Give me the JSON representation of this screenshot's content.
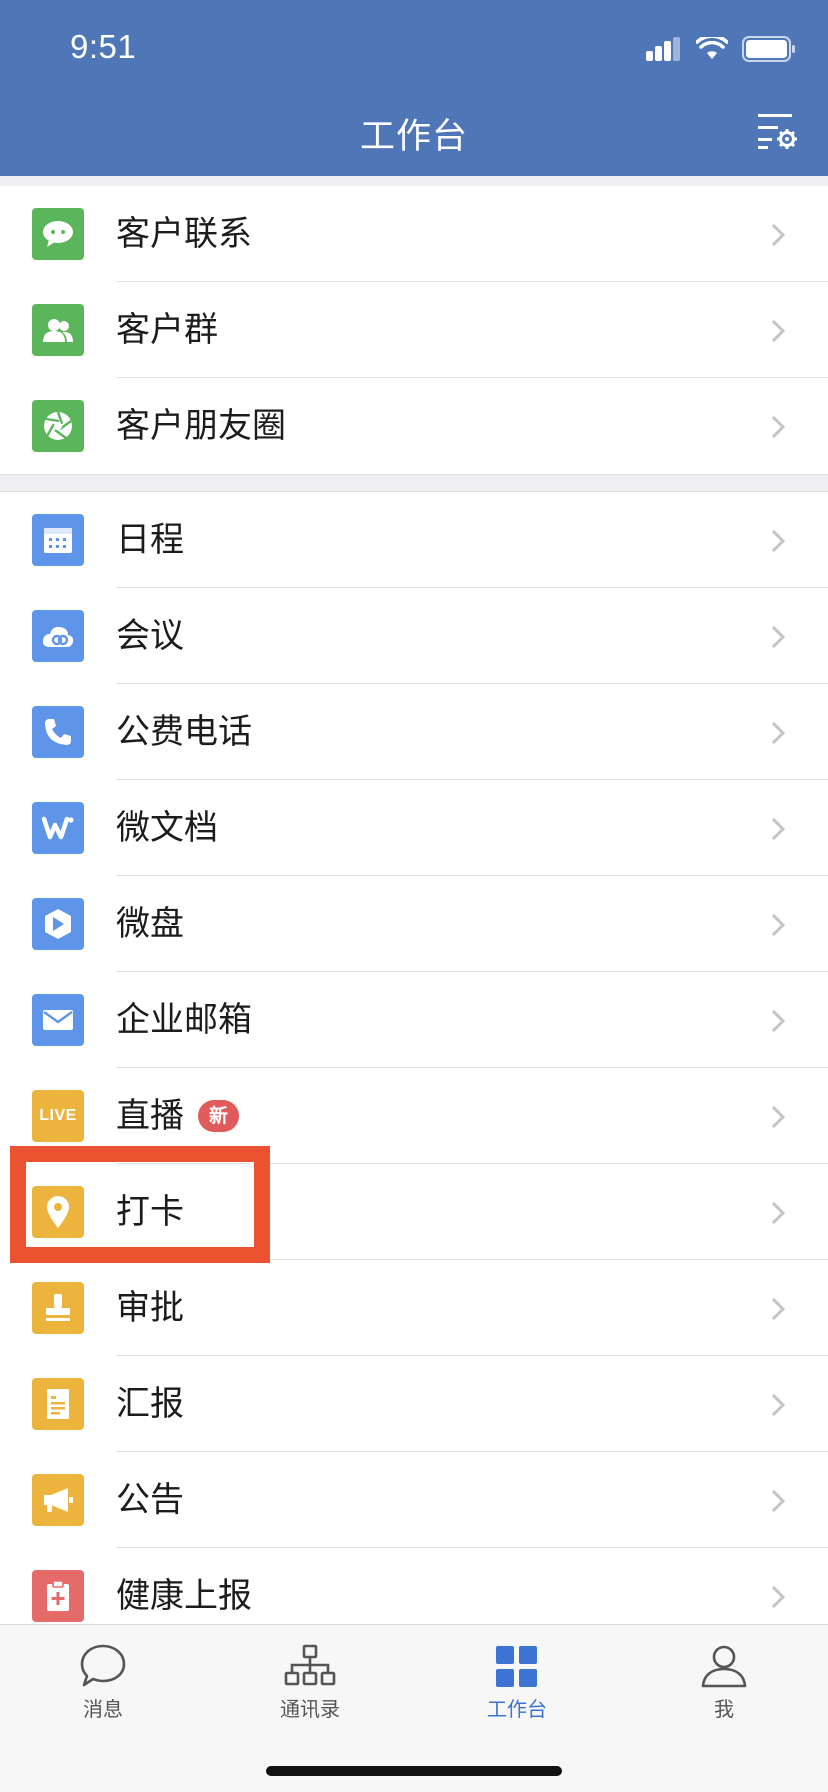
{
  "status_bar": {
    "time": "9:51"
  },
  "header": {
    "title": "工作台",
    "settings_icon": "list-settings-icon"
  },
  "groups": [
    {
      "items": [
        {
          "label": "客户联系",
          "icon": "chat-bubble-icon",
          "color": "#5bb65b"
        },
        {
          "label": "客户群",
          "icon": "people-icon",
          "color": "#5bb65b"
        },
        {
          "label": "客户朋友圈",
          "icon": "aperture-icon",
          "color": "#5bb65b"
        }
      ]
    },
    {
      "items": [
        {
          "label": "日程",
          "icon": "calendar-icon",
          "color": "#5f95e8"
        },
        {
          "label": "会议",
          "icon": "cloud-icon",
          "color": "#5f95e8"
        },
        {
          "label": "公费电话",
          "icon": "phone-icon",
          "color": "#5f95e8"
        },
        {
          "label": "微文档",
          "icon": "doc-w-icon",
          "color": "#5f95e8"
        },
        {
          "label": "微盘",
          "icon": "drive-icon",
          "color": "#5f95e8"
        },
        {
          "label": "企业邮箱",
          "icon": "mail-icon",
          "color": "#5f95e8"
        },
        {
          "label": "直播",
          "icon": "live-icon",
          "color": "#ecb43c",
          "badge": "新"
        },
        {
          "label": "打卡",
          "icon": "location-pin-icon",
          "color": "#ecb43c"
        },
        {
          "label": "审批",
          "icon": "stamp-icon",
          "color": "#ecb43c"
        },
        {
          "label": "汇报",
          "icon": "report-icon",
          "color": "#ecb43c"
        },
        {
          "label": "公告",
          "icon": "megaphone-icon",
          "color": "#ecb43c"
        },
        {
          "label": "健康上报",
          "icon": "health-clipboard-icon",
          "color": "#e56b6b"
        }
      ]
    }
  ],
  "live_icon_text": "LIVE",
  "highlighted_item": "打卡",
  "tabbar": {
    "active_color": "#3d73d3",
    "tabs": [
      {
        "label": "消息",
        "icon": "message-bubble-icon",
        "active": false
      },
      {
        "label": "通讯录",
        "icon": "org-chart-icon",
        "active": false
      },
      {
        "label": "工作台",
        "icon": "grid-icon",
        "active": true
      },
      {
        "label": "我",
        "icon": "person-icon",
        "active": false
      }
    ]
  }
}
